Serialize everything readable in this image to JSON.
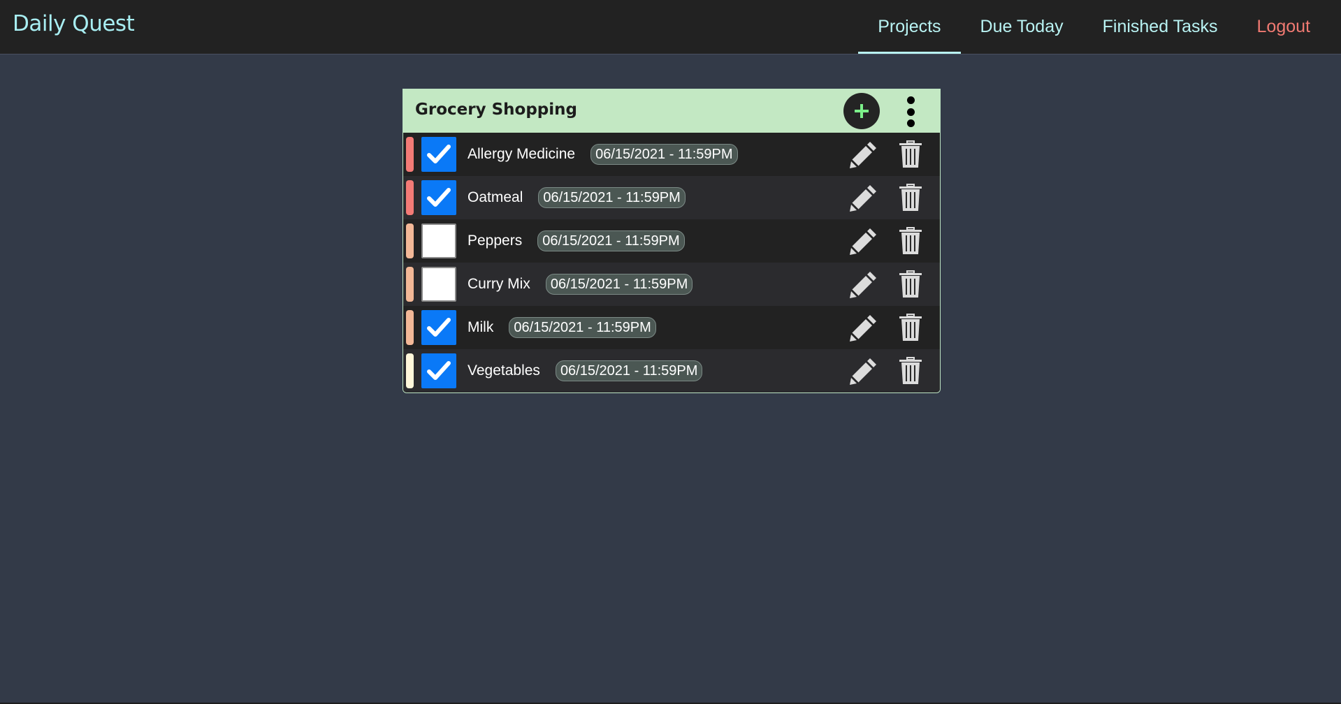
{
  "app": {
    "brand": "Daily Quest"
  },
  "nav": {
    "items": [
      {
        "label": "Projects",
        "active": true
      },
      {
        "label": "Due Today",
        "active": false
      },
      {
        "label": "Finished Tasks",
        "active": false
      },
      {
        "label": "Logout",
        "active": false
      }
    ]
  },
  "project": {
    "title": "Grocery Shopping",
    "add_icon": "plus-icon",
    "menu_icon": "kebab-menu-icon",
    "tasks": [
      {
        "name": "Allergy Medicine",
        "due": "06/15/2021 - 11:59PM",
        "done": true,
        "priority_color": "#f47b76"
      },
      {
        "name": "Oatmeal",
        "due": "06/15/2021 - 11:59PM",
        "done": true,
        "priority_color": "#f47b76"
      },
      {
        "name": "Peppers",
        "due": "06/15/2021 - 11:59PM",
        "done": false,
        "priority_color": "#f3b897"
      },
      {
        "name": "Curry Mix",
        "due": "06/15/2021 - 11:59PM",
        "done": false,
        "priority_color": "#f3b897"
      },
      {
        "name": "Milk",
        "due": "06/15/2021 - 11:59PM",
        "done": true,
        "priority_color": "#f3b897"
      },
      {
        "name": "Vegetables",
        "due": "06/15/2021 - 11:59PM",
        "done": true,
        "priority_color": "#fff7da"
      }
    ]
  },
  "colors": {
    "accent": "#b9f3f3",
    "logout": "#f17a72",
    "header_bg": "#c3e8c3",
    "checkbox_checked": "#0a79f7",
    "plus": "#7cf08a"
  }
}
